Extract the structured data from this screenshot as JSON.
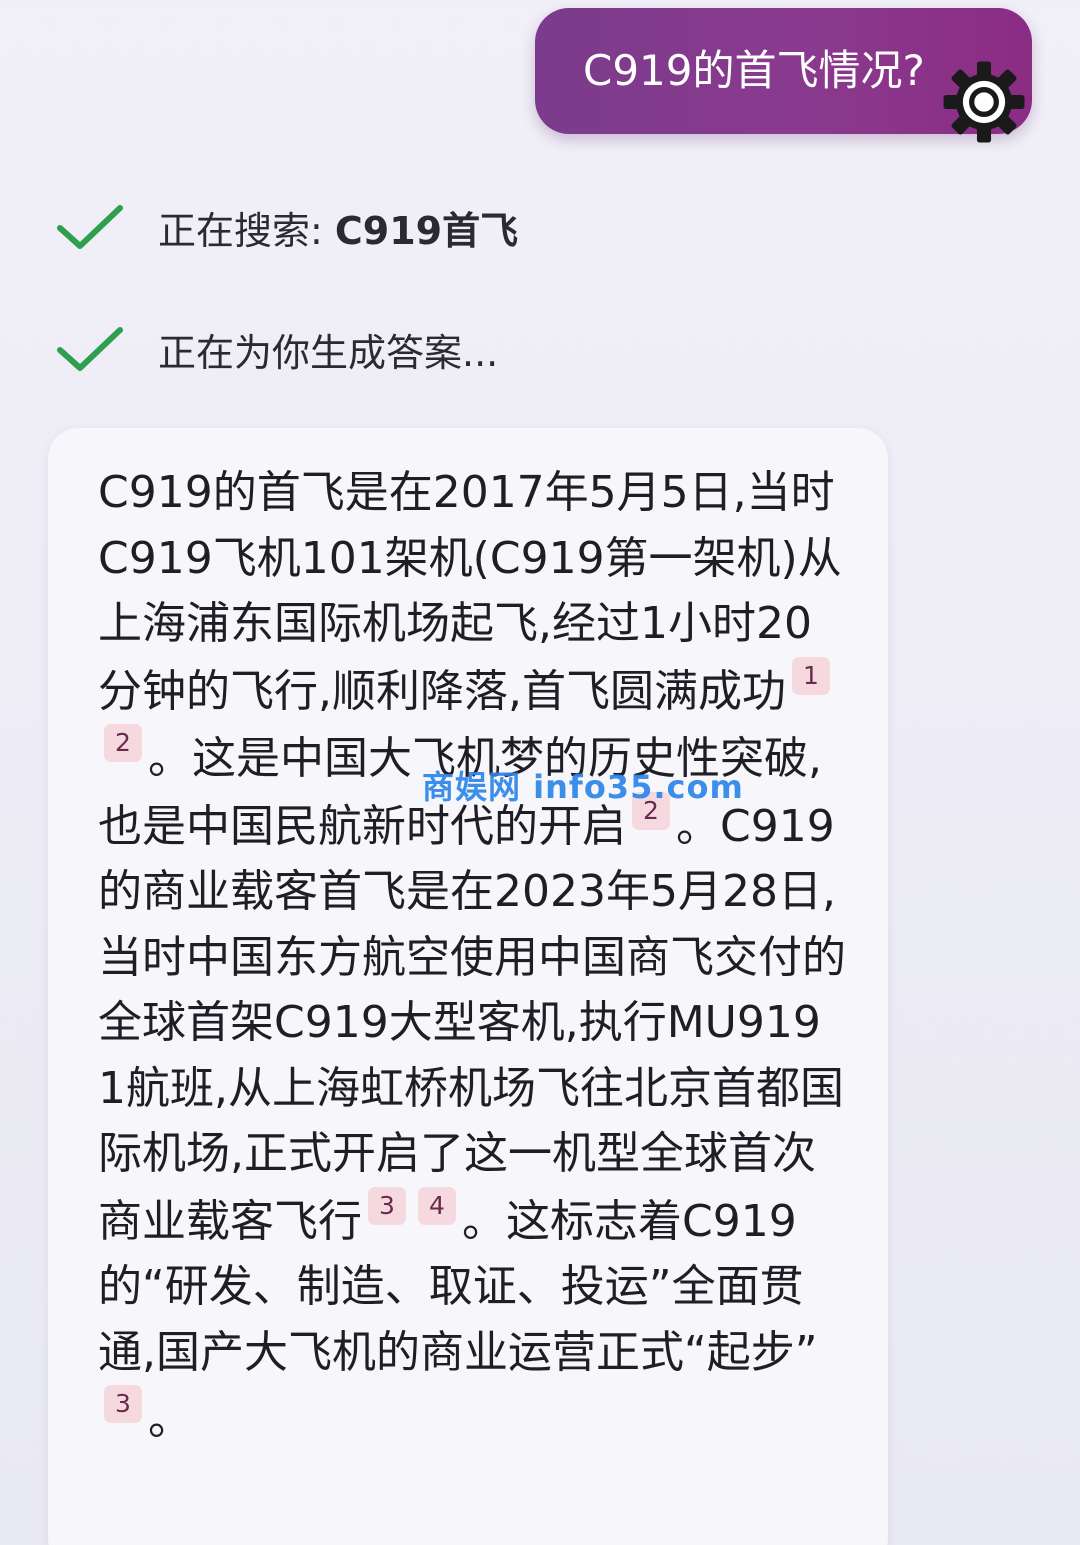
{
  "user_message": {
    "text": "C919的首飞情况?"
  },
  "icons": {
    "settings": "gear-icon",
    "status": "check-icon"
  },
  "colors": {
    "bubble_start": "#7b3b8c",
    "bubble_end": "#8b2c83",
    "check": "#2e9e4f",
    "citation_bg": "#f6d9df",
    "watermark": "#2c86e8"
  },
  "status": {
    "search_prefix": "正在搜索: ",
    "search_query": "C919首飞",
    "generating": "正在为你生成答案..."
  },
  "answer": {
    "p1": "C919的首飞是在2017年5月5日,当时C919飞机101架机(C919第一架机)从上海浦东国际机场起飞,经过1小时20分钟的飞行,顺利降落,首飞圆满成功",
    "c1": "1",
    "c2": "2",
    "p2": "。这是中国大飞机梦的历史性突破,也是中国民航新时代的开启",
    "c3": "2",
    "p3": "。C919的商业载客首飞是在2023年5月28日,当时中国东方航空使用中国商飞交付的全球首架C919大型客机,执行MU9191航班,从上海虹桥机场飞往北京首都国际机场,正式开启了这一机型全球首次商业载客飞行",
    "c4": "3",
    "c5": "4",
    "p4": "。这标志着C919的“研发、制造、取证、投运”全面贯通,国产大飞机的商业运营正式“起步”",
    "c6": "3",
    "p5": "。"
  },
  "watermark": {
    "text": "商娱网 info35.com"
  }
}
